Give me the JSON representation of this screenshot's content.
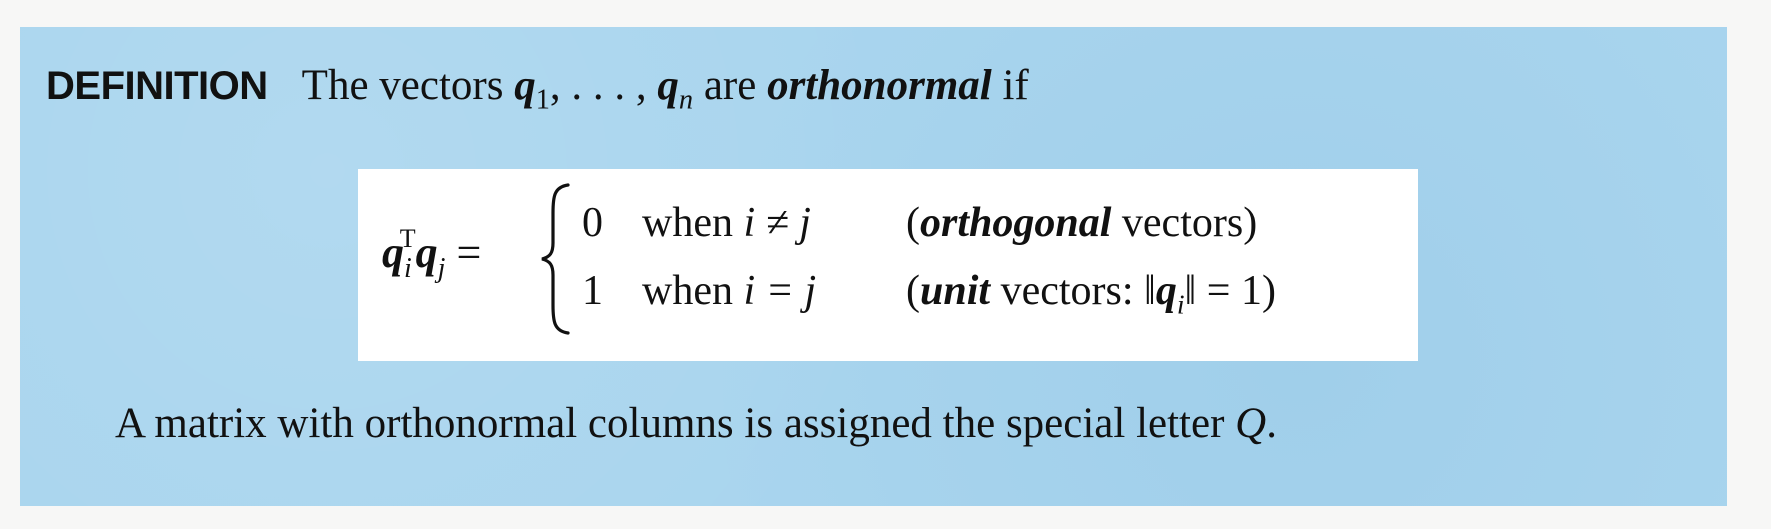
{
  "heading": {
    "label": "DEFINITION",
    "lead": "The vectors",
    "q1_sym": "q",
    "q1_sub": "1",
    "ellipsis": ", . . . , ",
    "qn_sym": "q",
    "qn_sub": "n",
    "are": " are ",
    "term": "orthonormal",
    "if": " if"
  },
  "formula": {
    "lhs_q": "q",
    "lhs_sub_i": "i",
    "lhs_sup": "T",
    "lhs_q2": "q",
    "lhs_sub_j": "j",
    "equals": " =",
    "rows": [
      {
        "value": "0",
        "condition_word": "when ",
        "condition": "i ≠ j",
        "note_open": "(",
        "note_term": "orthogonal",
        "note_rest": " vectors)"
      },
      {
        "value": "1",
        "condition_word": "when ",
        "condition": "i = j",
        "note_open": "(",
        "note_term": "unit",
        "note_rest_a": " vectors: ‖",
        "note_q": "q",
        "note_q_sub": "i",
        "note_rest_b": "‖ = 1)"
      }
    ]
  },
  "footer": {
    "text": "A matrix with orthonormal columns is assigned the special letter ",
    "letter": "Q",
    "period": "."
  }
}
